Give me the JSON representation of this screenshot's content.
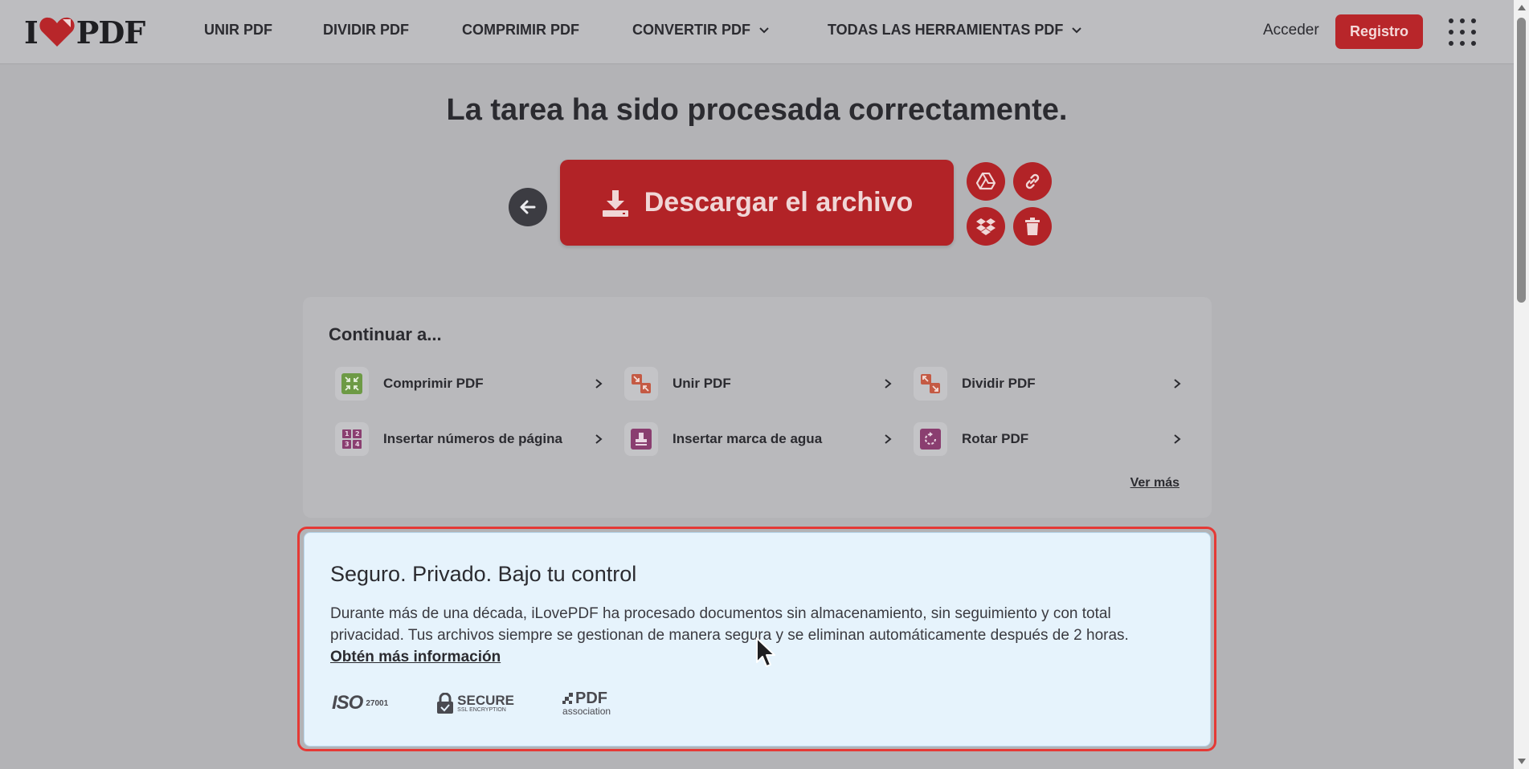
{
  "brand": {
    "logo_left": "I",
    "logo_right": "PDF",
    "accent": "#b8262a"
  },
  "nav": {
    "items": [
      {
        "label": "UNIR PDF",
        "dropdown": false
      },
      {
        "label": "DIVIDIR PDF",
        "dropdown": false
      },
      {
        "label": "COMPRIMIR PDF",
        "dropdown": false
      },
      {
        "label": "CONVERTIR PDF",
        "dropdown": true
      },
      {
        "label": "TODAS LAS HERRAMIENTAS PDF",
        "dropdown": true
      }
    ],
    "login_label": "Acceder",
    "register_label": "Registro"
  },
  "main": {
    "title": "La tarea ha sido procesada correctamente.",
    "download_label": "Descargar el archivo",
    "actions": [
      "google-drive-icon",
      "link-icon",
      "dropbox-icon",
      "trash-icon"
    ]
  },
  "continue": {
    "title": "Continuar a...",
    "tools": [
      {
        "label": "Comprimir PDF",
        "icon": "compress-icon",
        "color": "#6d9a45"
      },
      {
        "label": "Unir PDF",
        "icon": "merge-icon",
        "color": "#c45a44"
      },
      {
        "label": "Dividir PDF",
        "icon": "split-icon",
        "color": "#c45a44"
      },
      {
        "label": "Insertar números de página",
        "icon": "page-numbers-icon",
        "color": "#8a3e70"
      },
      {
        "label": "Insertar marca de agua",
        "icon": "watermark-icon",
        "color": "#8a3e70"
      },
      {
        "label": "Rotar PDF",
        "icon": "rotate-icon",
        "color": "#8a3e70"
      }
    ],
    "more_label": "Ver más"
  },
  "security": {
    "title": "Seguro. Privado. Bajo tu control",
    "description": "Durante más de una década, iLovePDF ha procesado documentos sin almacenamiento, sin seguimiento y con total privacidad. Tus archivos siempre se gestionan de manera segura y se eliminan automáticamente después de 2 horas.",
    "link_label": "Obtén más información",
    "badges": {
      "iso": {
        "main": "ISO",
        "sub": "27001"
      },
      "ssl": {
        "main": "SECURE",
        "sub": "SSL ENCRYPTION"
      },
      "pdfa": {
        "main": "PDF",
        "sub": "association"
      }
    }
  }
}
